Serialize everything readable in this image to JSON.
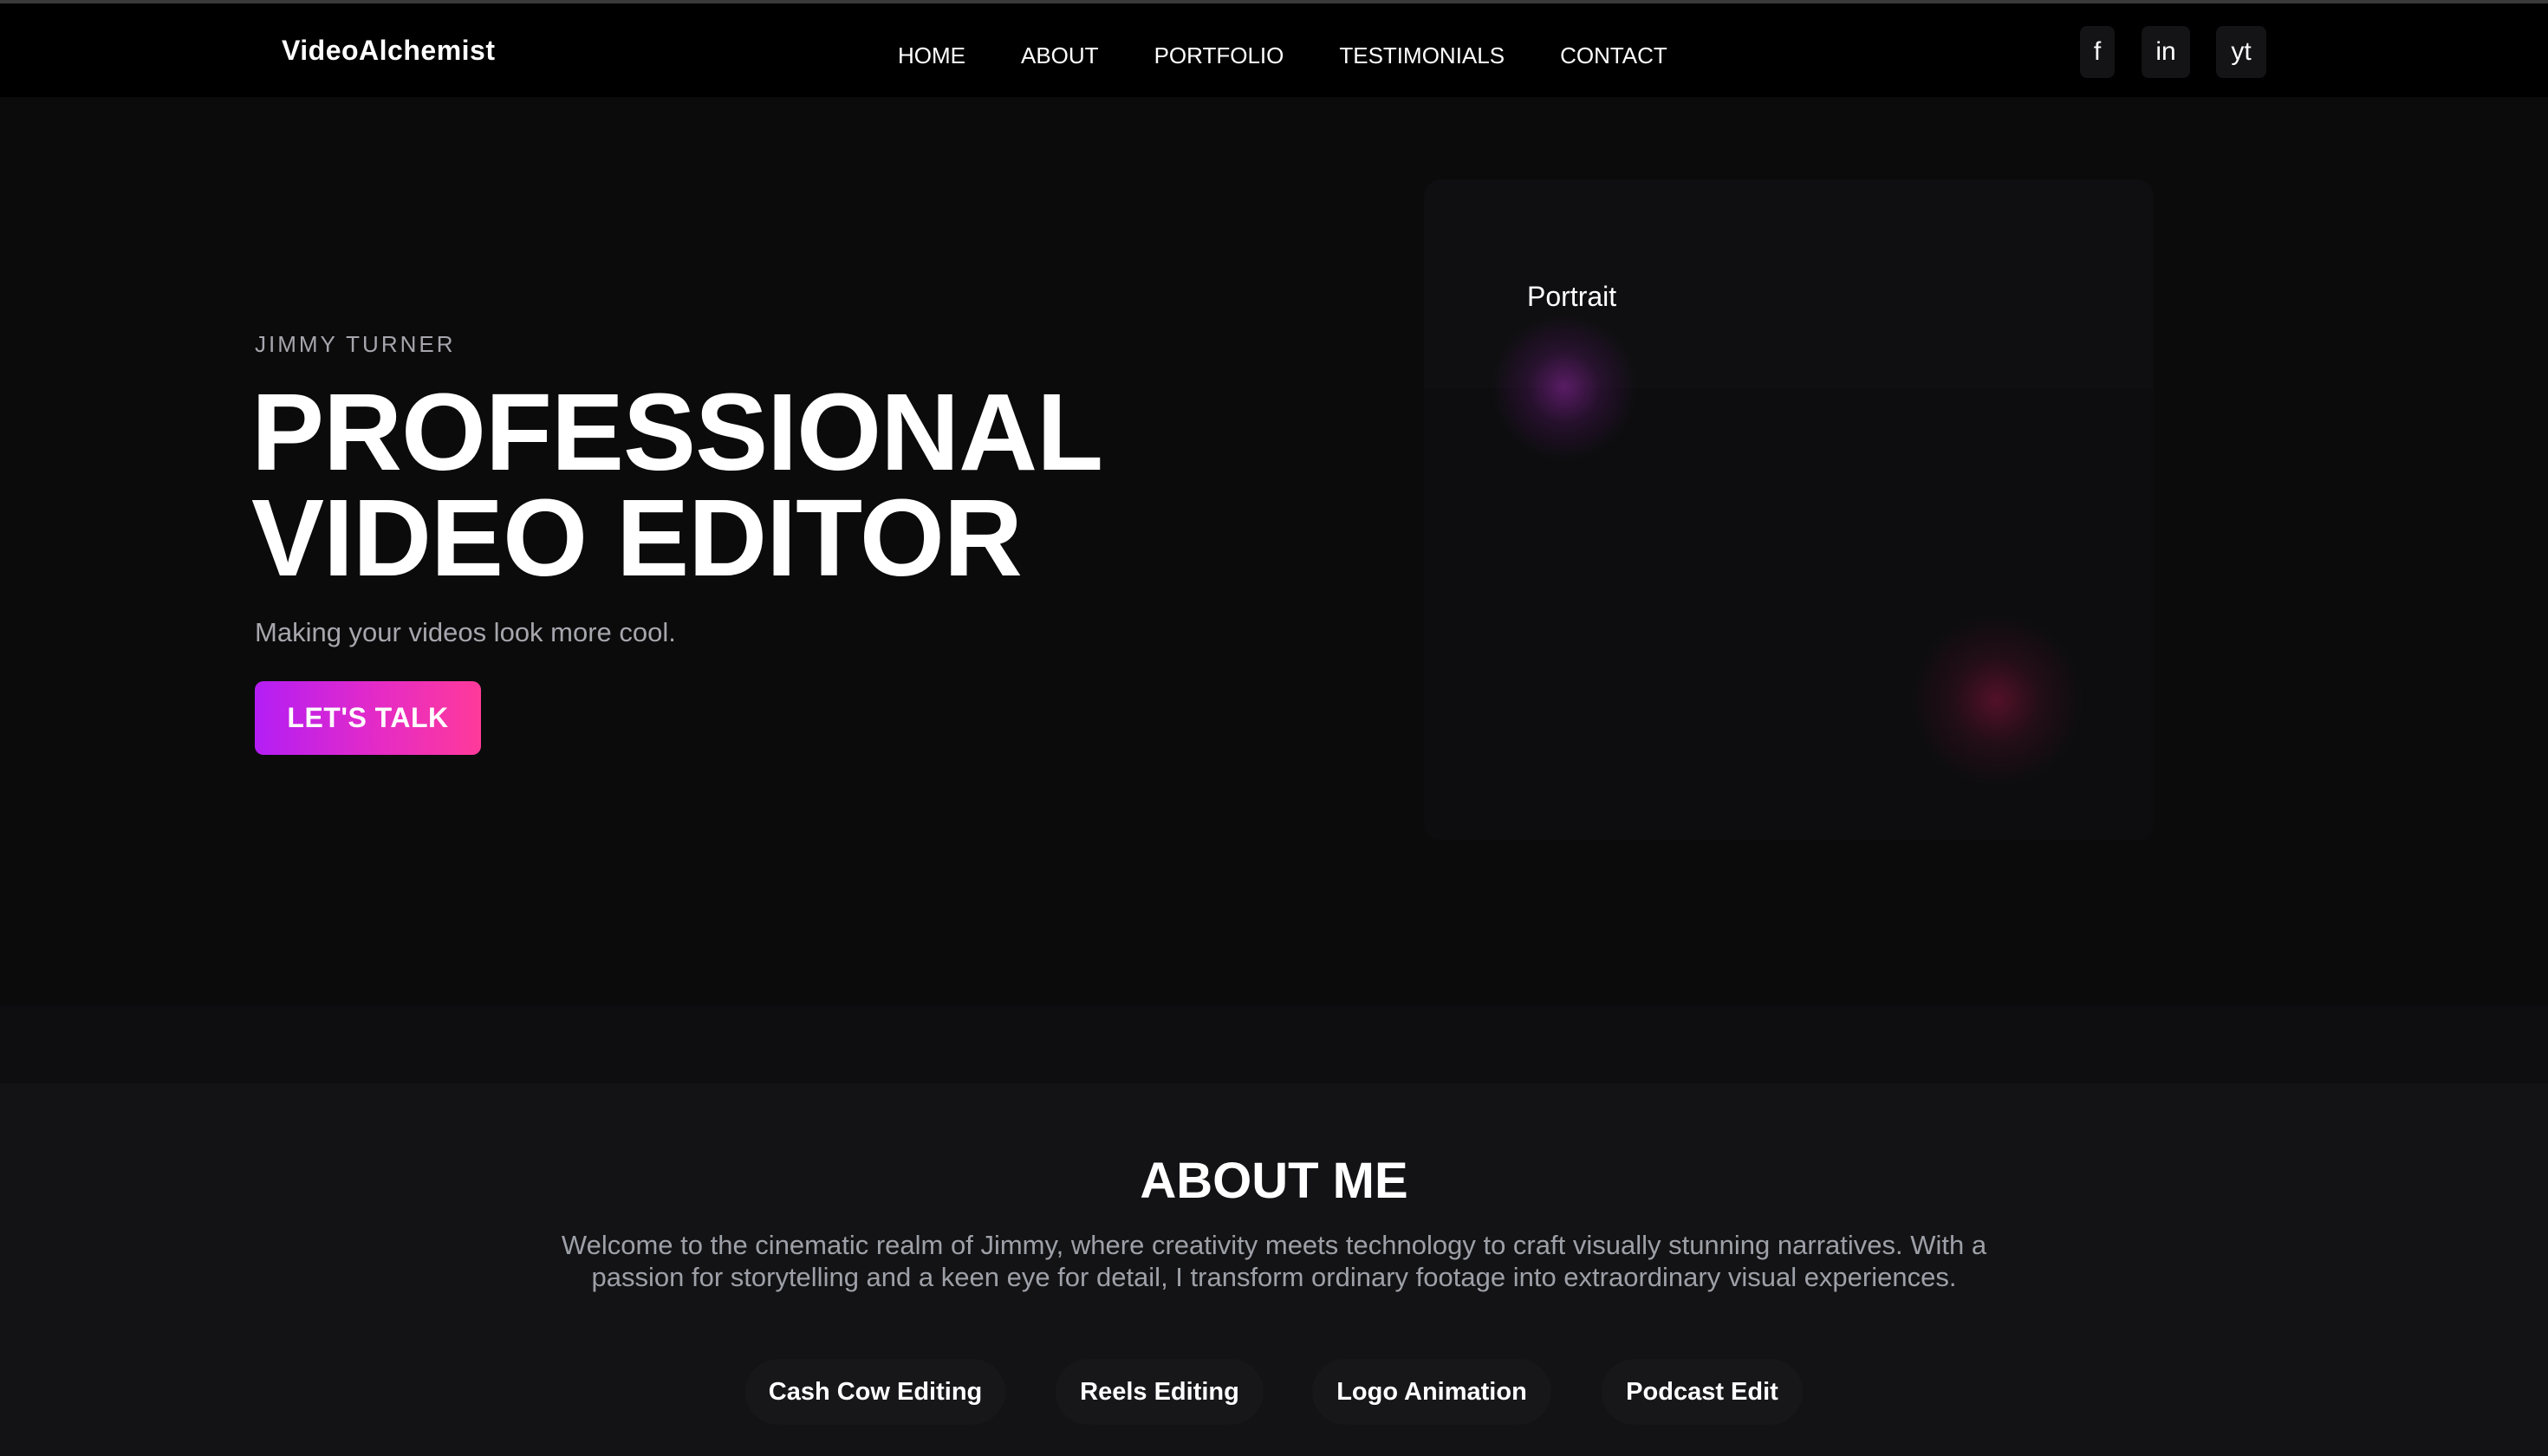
{
  "brand": {
    "name": "VideoAlchemist"
  },
  "nav": {
    "links": [
      "HOME",
      "ABOUT",
      "PORTFOLIO",
      "TESTIMONIALS",
      "CONTACT"
    ]
  },
  "socials": [
    {
      "label": "f",
      "icon": "facebook-icon"
    },
    {
      "label": "in",
      "icon": "linkedin-icon"
    },
    {
      "label": "yt",
      "icon": "youtube-icon"
    }
  ],
  "hero": {
    "eyebrow": "JIMMY TURNER",
    "title_line1": "PROFESSIONAL",
    "title_line2": "VIDEO EDITOR",
    "subtitle": "Making your videos look more cool.",
    "cta_label": "LET'S TALK",
    "portrait_label": "Portrait"
  },
  "about": {
    "title": "ABOUT ME",
    "text": "Welcome to the cinematic realm of Jimmy, where creativity meets technology to craft visually stunning narratives. With a passion for storytelling and a keen eye for detail, I transform ordinary footage into extraordinary visual experiences.",
    "services": [
      "Cash Cow Editing",
      "Reels Editing",
      "Logo Animation",
      "Podcast Edit"
    ]
  },
  "colors": {
    "background": "#0b0b0c",
    "navbar": "#000000",
    "cta_gradient_start": "#b31ef5",
    "cta_gradient_end": "#ff3a9a",
    "muted_text": "#a6a6ad"
  }
}
